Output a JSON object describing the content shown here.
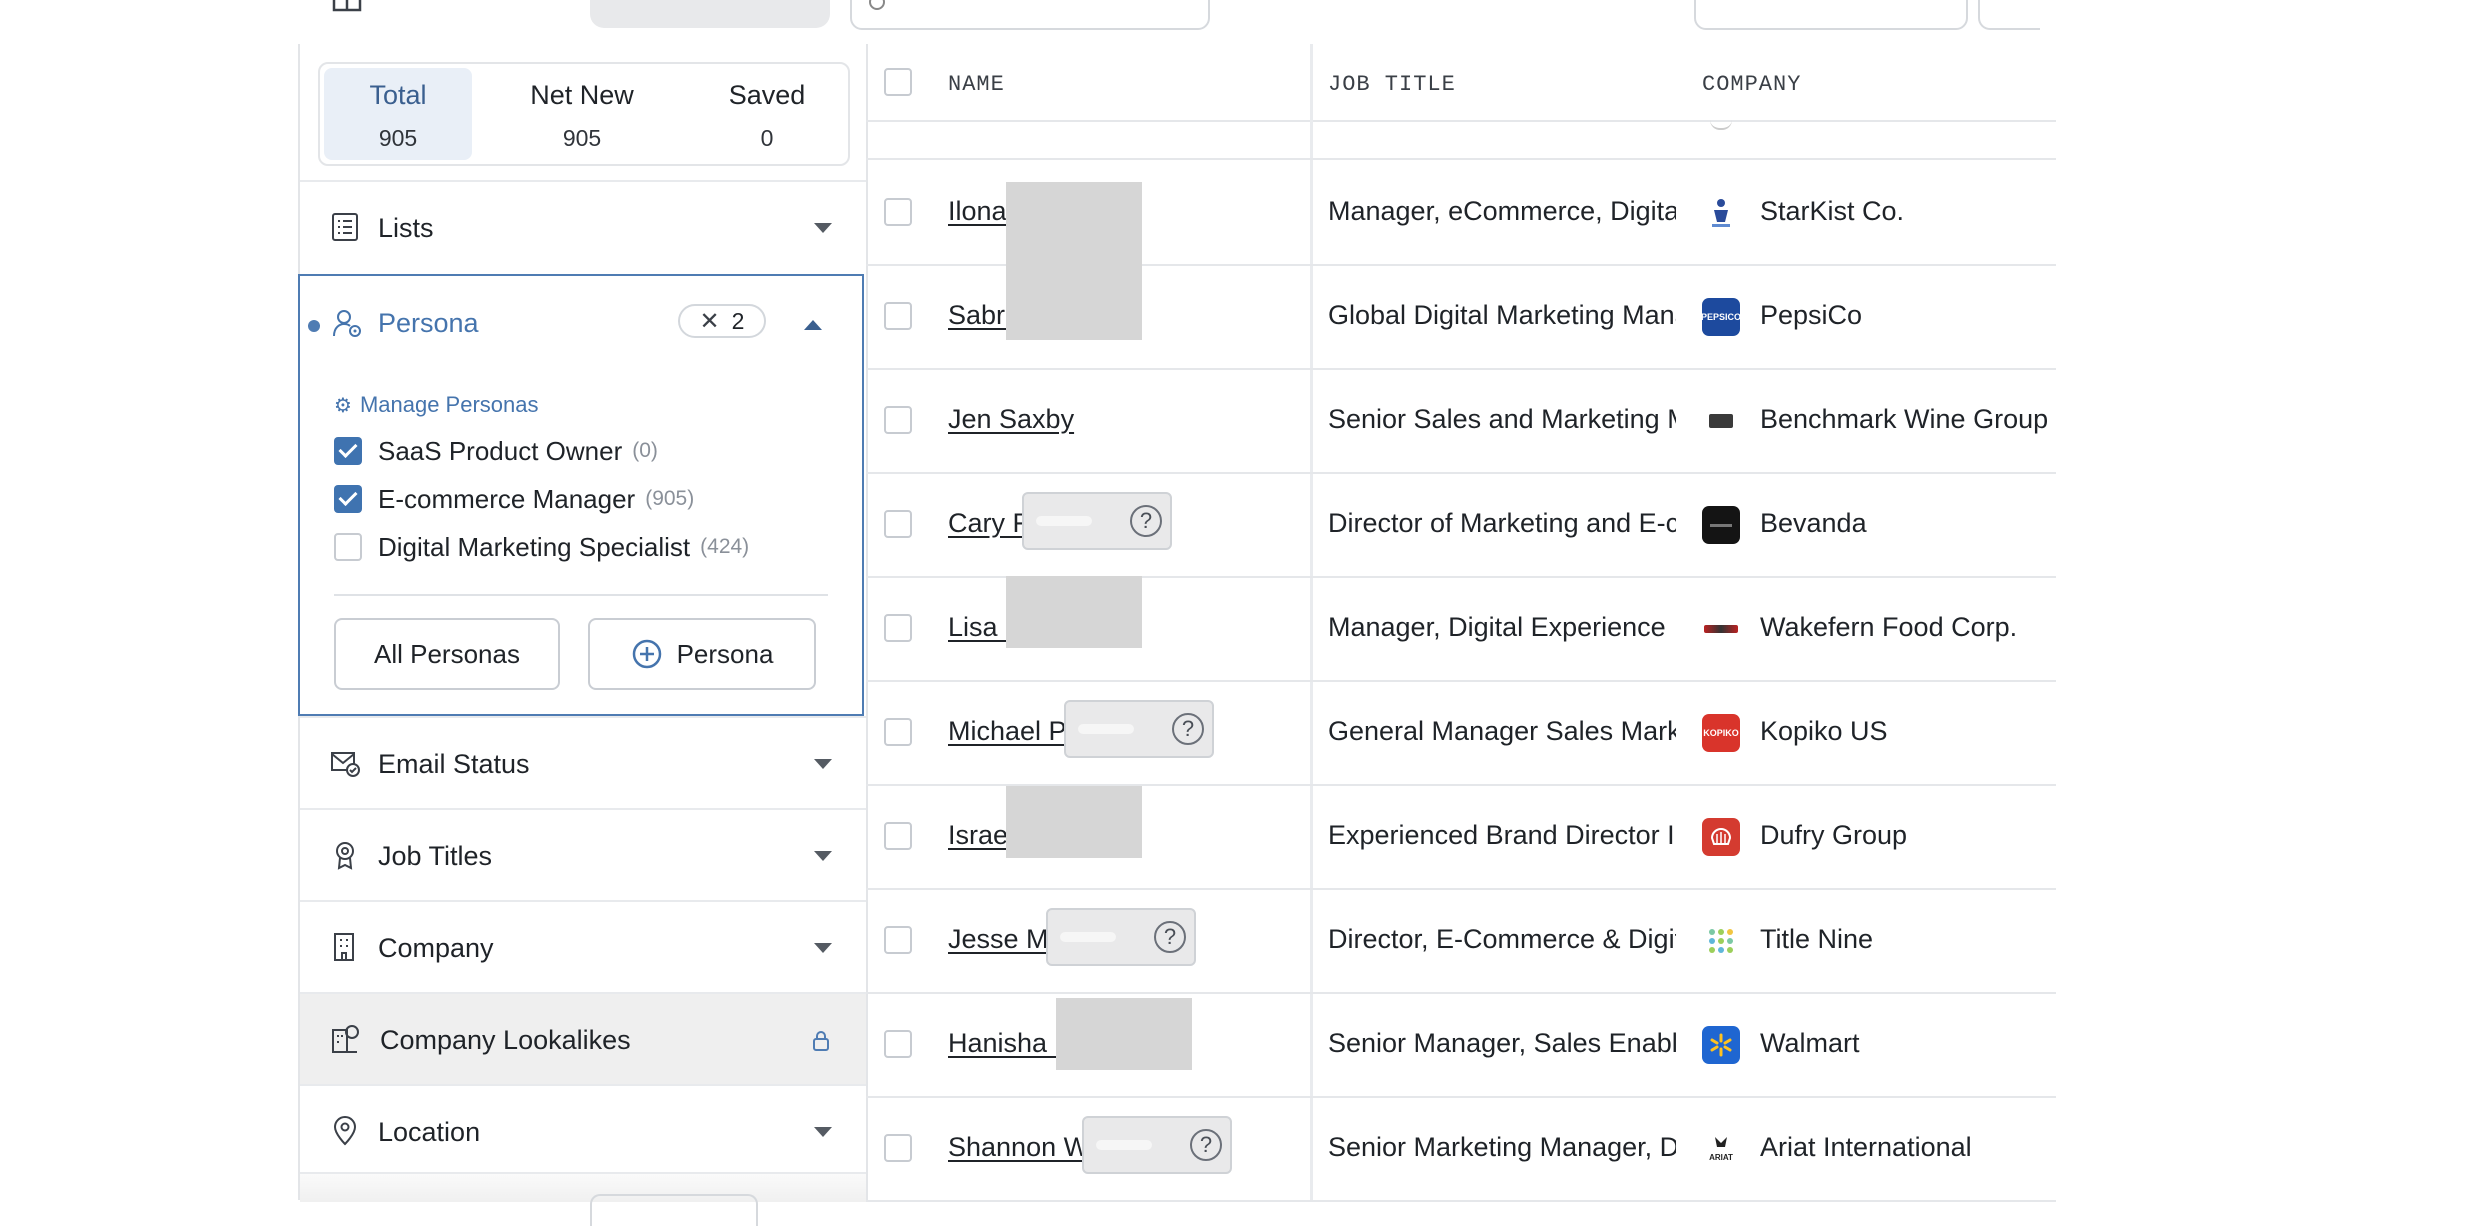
{
  "stats": [
    {
      "label": "Total",
      "value": "905"
    },
    {
      "label": "Net New",
      "value": "905"
    },
    {
      "label": "Saved",
      "value": "0"
    }
  ],
  "filters": {
    "lists": "Lists",
    "persona": "Persona",
    "email_status": "Email Status",
    "job_titles": "Job Titles",
    "company": "Company",
    "company_lookalikes": "Company Lookalikes",
    "location": "Location"
  },
  "persona_panel": {
    "selected_count": "2",
    "manage_label": "Manage Personas",
    "options": [
      {
        "label": "SaaS Product Owner",
        "count": "(0)",
        "checked": true
      },
      {
        "label": "E-commerce Manager",
        "count": "(905)",
        "checked": true
      },
      {
        "label": "Digital Marketing Specialist",
        "count": "(424)",
        "checked": false
      }
    ],
    "all_personas_button": "All Personas",
    "add_persona_button": "Persona"
  },
  "table": {
    "headers": {
      "name": "NAME",
      "job_title": "JOB TITLE",
      "company": "COMPANY"
    },
    "rows": [
      {
        "name": "Ilona",
        "title": "Manager, eCommerce, Digital",
        "company": "StarKist Co.",
        "logo_color": "#ffffff"
      },
      {
        "name": "Sabri",
        "title": "Global Digital Marketing Manager",
        "company": "PepsiCo",
        "logo_color": "#1d4a9e"
      },
      {
        "name": "Jen Saxby",
        "title": "Senior Sales and Marketing Manager",
        "company": "Benchmark Wine Group",
        "logo_color": "#ffffff"
      },
      {
        "name": "Cary F",
        "title": "Director of Marketing and E-commerce",
        "company": "Bevanda",
        "logo_color": "#141414"
      },
      {
        "name": "Lisa H",
        "title": "Manager, Digital Experience",
        "company": "Wakefern Food Corp.",
        "logo_color": "#ffffff"
      },
      {
        "name": "Michael P",
        "title": "General Manager Sales Marketing",
        "company": "Kopiko US",
        "logo_color": "#d9342b"
      },
      {
        "name": "Israel",
        "title": "Experienced Brand Director I Global",
        "company": "Dufry Group",
        "logo_color": "#d43b30"
      },
      {
        "name": "Jesse M",
        "title": "Director, E-Commerce & Digital",
        "company": "Title Nine",
        "logo_color": "#ffffff"
      },
      {
        "name": "Hanisha G",
        "title": "Senior Manager, Sales Enablement",
        "company": "Walmart",
        "logo_color": "#1f66d1"
      },
      {
        "name": "Shannon W",
        "title": "Senior Marketing Manager, Digital",
        "company": "Ariat International",
        "logo_color": "#ffffff"
      }
    ]
  }
}
